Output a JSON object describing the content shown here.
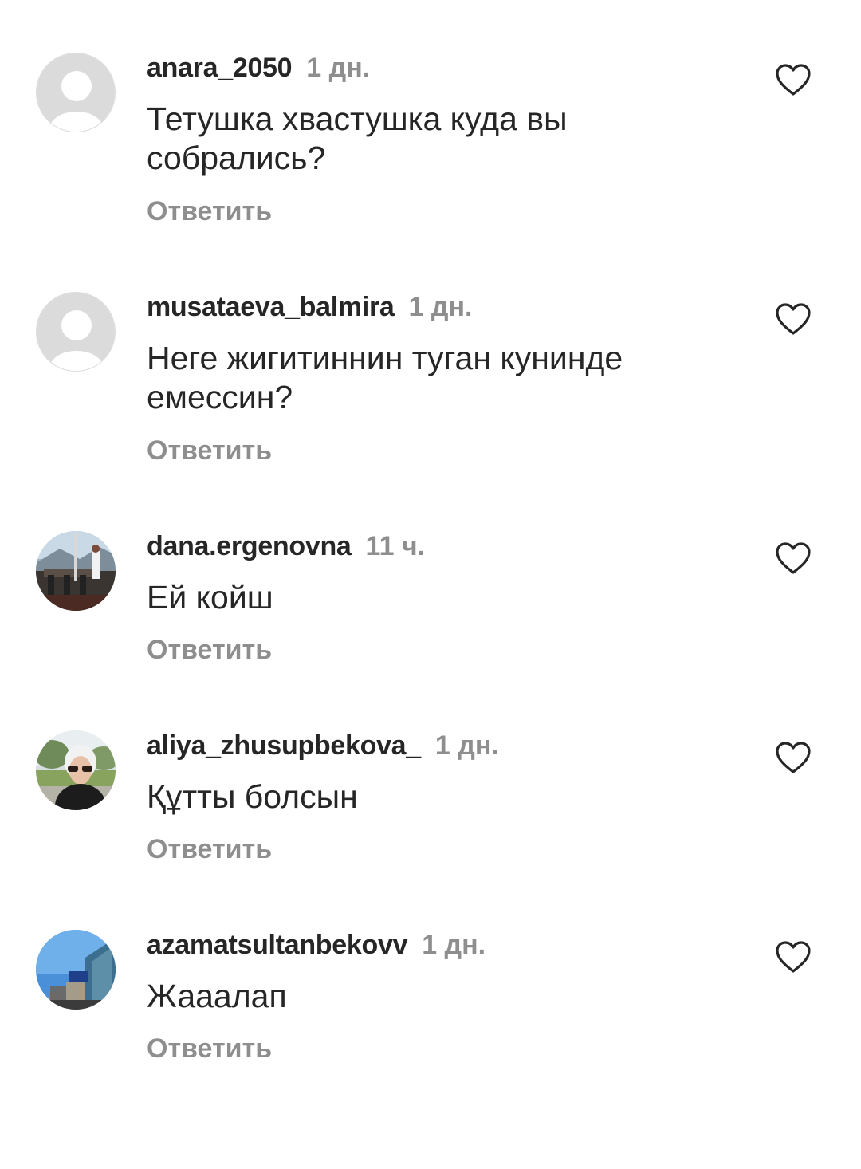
{
  "comments": [
    {
      "username": "anara_2050",
      "time": "1 дн.",
      "text": "Тетушка хвастушка куда вы собрались?",
      "reply": "Ответить",
      "avatar": "default-avatar"
    },
    {
      "username": "musataeva_balmira",
      "time": "1 дн.",
      "text": "Неге жигитиннин туган кунинде емессин?",
      "reply": "Ответить",
      "avatar": "default-avatar"
    },
    {
      "username": "dana.ergenovna",
      "time": "11 ч.",
      "text": "Ей койш",
      "reply": "Ответить",
      "avatar": "photo-avatar"
    },
    {
      "username": "aliya_zhusupbekova_",
      "time": "1 дн.",
      "text": "Құтты болсын",
      "reply": "Ответить",
      "avatar": "photo-avatar"
    },
    {
      "username": "azamatsultanbekovv",
      "time": "1 дн.",
      "text": "Жааалап",
      "reply": "Ответить",
      "avatar": "photo-avatar"
    }
  ],
  "colors": {
    "primary_text": "#262626",
    "secondary_text": "#8e8e8e",
    "default_avatar_bg": "#dbdbdb"
  },
  "icons": {
    "like": "heart-outline-icon"
  }
}
